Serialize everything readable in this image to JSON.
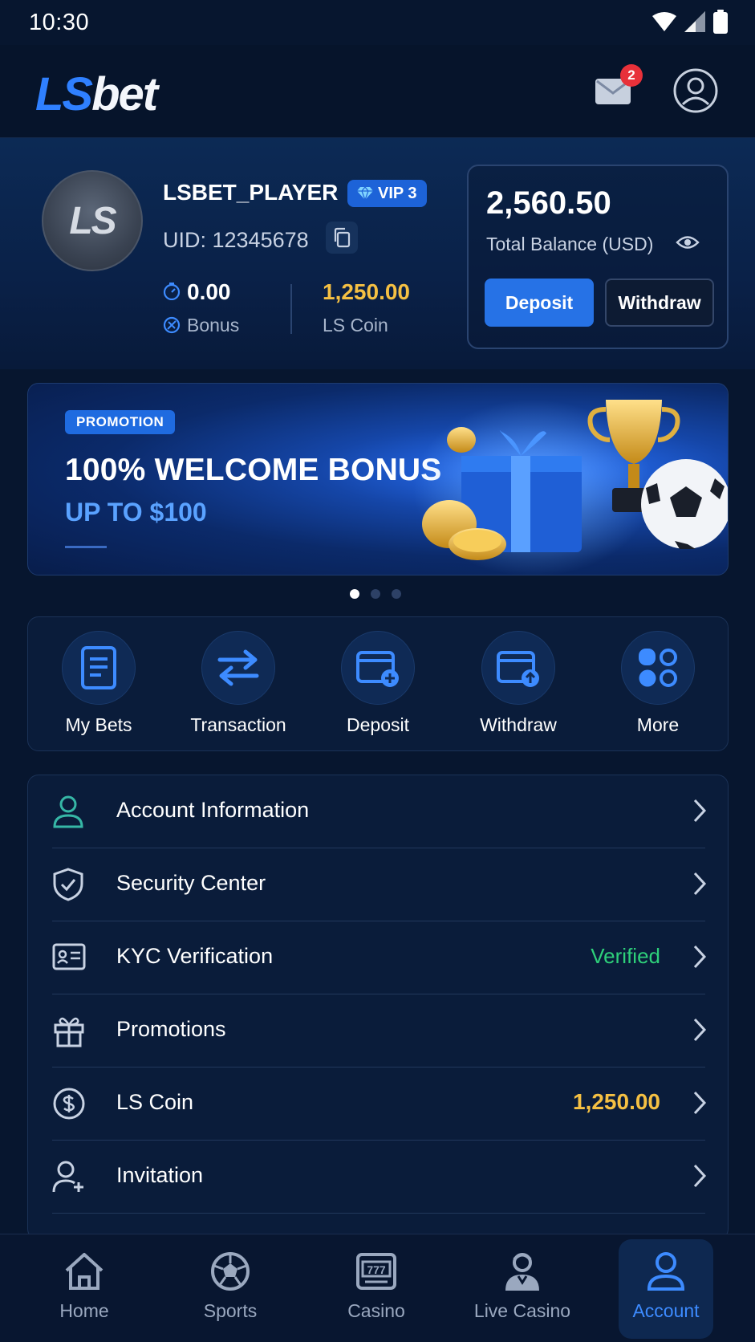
{
  "status_bar": {
    "time": "10:30"
  },
  "header": {
    "logo_ls": "LS",
    "logo_bet": "bet",
    "mail_badge": "2"
  },
  "profile": {
    "avatar_text": "LS",
    "username": "LSBET_PLAYER",
    "vip_label": "VIP 3",
    "uid": "UID: 12345678",
    "bonus_value": "0.00",
    "bonus_label": "Bonus",
    "coin_value": "1,250.00",
    "coin_label": "LS Coin"
  },
  "balance": {
    "amount": "2,560.50",
    "label": "Total Balance (USD)",
    "deposit_label": "Deposit",
    "withdraw_label": "Withdraw"
  },
  "banner": {
    "tag": "PROMOTION",
    "title": "100% WELCOME BONUS",
    "subtitle": "UP TO $100",
    "slides": 3,
    "active_slide": 1
  },
  "quick_actions": [
    {
      "label": "My Bets",
      "icon": "document-icon"
    },
    {
      "label": "Transaction",
      "icon": "swap-arrows-icon"
    },
    {
      "label": "Deposit",
      "icon": "wallet-plus-icon"
    },
    {
      "label": "Withdraw",
      "icon": "wallet-up-icon"
    },
    {
      "label": "More",
      "icon": "grid-icon"
    }
  ],
  "menu": [
    {
      "label": "Account Information",
      "icon": "user-icon",
      "value": ""
    },
    {
      "label": "Security Center",
      "icon": "shield-icon",
      "value": ""
    },
    {
      "label": "KYC Verification",
      "icon": "id-card-icon",
      "value": "Verified"
    },
    {
      "label": "Promotions",
      "icon": "gift-icon",
      "value": ""
    },
    {
      "label": "LS Coin",
      "icon": "coin-icon",
      "value": "1,250.00"
    },
    {
      "label": "Invitation",
      "icon": "user-plus-icon",
      "value": ""
    }
  ],
  "bottom_nav": [
    {
      "label": "Home",
      "icon": "home-icon"
    },
    {
      "label": "Sports",
      "icon": "soccer-ball-icon"
    },
    {
      "label": "Casino",
      "icon": "slot-machine-icon"
    },
    {
      "label": "Live Casino",
      "icon": "dealer-icon"
    },
    {
      "label": "Account",
      "icon": "account-icon",
      "active": true
    }
  ],
  "colors": {
    "background": "#07162f",
    "accent": "#2f80ff",
    "gold": "#f5c043",
    "verified": "#2ed07a",
    "badge": "#e8313a"
  }
}
